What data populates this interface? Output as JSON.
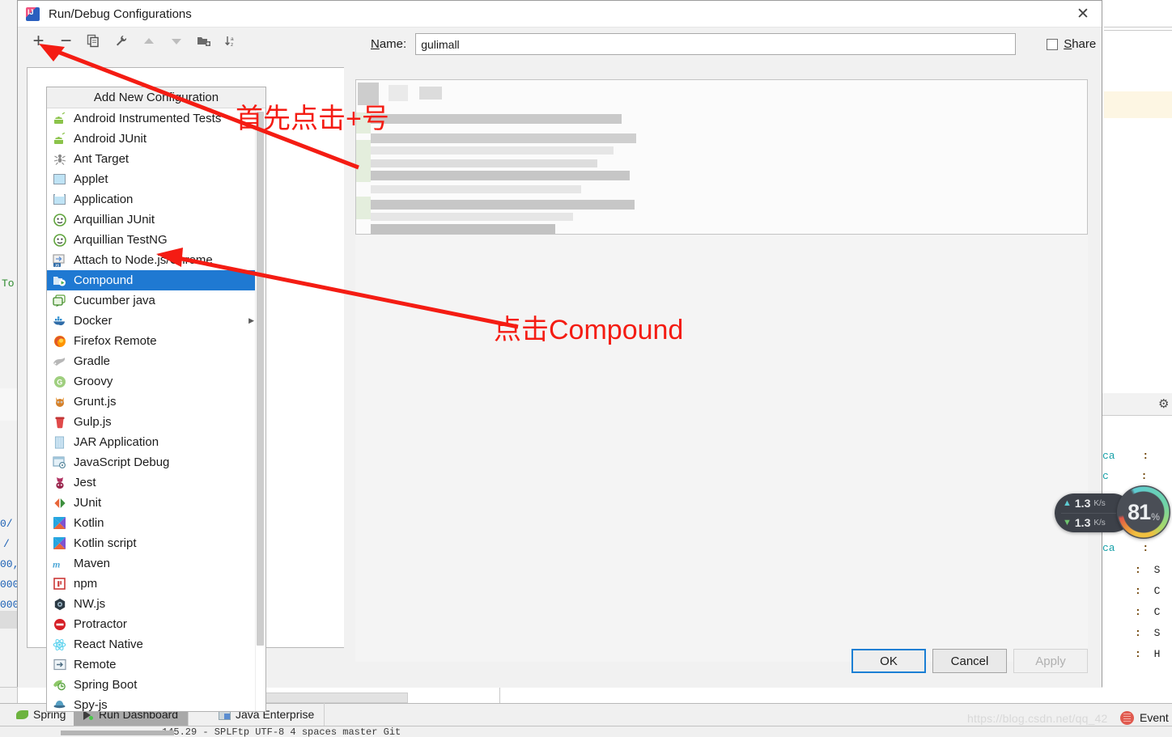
{
  "dialog": {
    "title": "Run/Debug Configurations",
    "icon": "intellij-logo-icon",
    "close_label": "✕",
    "toolbar": {
      "add_label": "+",
      "remove_label": "−",
      "copy_label": "copy-configuration-icon",
      "edit_templates_label": "wrench-icon",
      "move_up_label": "▲",
      "move_down_label": "▼",
      "new_folder_label": "new-folder-icon",
      "sort_label": "sort-alphabetically-icon"
    },
    "name_field": {
      "label_prefix": "N",
      "label_rest": "ame:",
      "value": "gulimall",
      "placeholder": ""
    },
    "share": {
      "label_prefix": "S",
      "label_rest": "hare",
      "checked": false
    },
    "buttons": {
      "ok": "OK",
      "cancel": "Cancel",
      "apply": "Apply"
    }
  },
  "popup": {
    "title": "Add New Configuration",
    "selected_index": 8,
    "selected_color": "#1f79d2",
    "items": [
      {
        "label": "Android Instrumented Tests",
        "icon": "android-icon"
      },
      {
        "label": "Android JUnit",
        "icon": "android-icon"
      },
      {
        "label": "Ant Target",
        "icon": "ant-icon"
      },
      {
        "label": "Applet",
        "icon": "applet-icon"
      },
      {
        "label": "Application",
        "icon": "application-icon"
      },
      {
        "label": "Arquillian JUnit",
        "icon": "arquillian-icon"
      },
      {
        "label": "Arquillian TestNG",
        "icon": "arquillian-icon"
      },
      {
        "label": "Attach to Node.js/Chrome",
        "icon": "nodejs-attach-icon"
      },
      {
        "label": "Compound",
        "icon": "compound-icon"
      },
      {
        "label": "Cucumber java",
        "icon": "cucumber-icon"
      },
      {
        "label": "Docker",
        "icon": "docker-icon",
        "submenu": "▶"
      },
      {
        "label": "Firefox Remote",
        "icon": "firefox-icon"
      },
      {
        "label": "Gradle",
        "icon": "gradle-icon"
      },
      {
        "label": "Groovy",
        "icon": "groovy-icon"
      },
      {
        "label": "Grunt.js",
        "icon": "grunt-icon"
      },
      {
        "label": "Gulp.js",
        "icon": "gulp-icon"
      },
      {
        "label": "JAR Application",
        "icon": "jar-icon"
      },
      {
        "label": "JavaScript Debug",
        "icon": "javascript-debug-icon"
      },
      {
        "label": "Jest",
        "icon": "jest-icon"
      },
      {
        "label": "JUnit",
        "icon": "junit-icon"
      },
      {
        "label": "Kotlin",
        "icon": "kotlin-icon"
      },
      {
        "label": "Kotlin script",
        "icon": "kotlin-icon"
      },
      {
        "label": "Maven",
        "icon": "maven-icon"
      },
      {
        "label": "npm",
        "icon": "npm-icon"
      },
      {
        "label": "NW.js",
        "icon": "nwjs-icon"
      },
      {
        "label": "Protractor",
        "icon": "protractor-icon"
      },
      {
        "label": "React Native",
        "icon": "react-icon"
      },
      {
        "label": "Remote",
        "icon": "remote-icon"
      },
      {
        "label": "Spring Boot",
        "icon": "spring-boot-icon"
      },
      {
        "label": "Spy-js",
        "icon": "spyjs-icon"
      }
    ]
  },
  "annotations": [
    {
      "text": "首先点击+号",
      "color": "#f41c13"
    },
    {
      "text": "点击Compound",
      "color": "#f41c13"
    }
  ],
  "ide": {
    "tool_tabs": [
      {
        "label": "Spring",
        "icon": "spring-leaf-icon",
        "active": false
      },
      {
        "label": "Run Dashboard",
        "icon": "run-icon",
        "active": true
      },
      {
        "label": "Java Enterprise",
        "icon": "java-enterprise-icon",
        "active": false
      }
    ],
    "event_label": "Event",
    "watermark": "https://blog.csdn.net/qq_42",
    "status_text": "145.29 - SPLFtp UTF-8 4 spaces master Git",
    "gutter_snippets": [
      "To",
      "0/",
      "/",
      "00,",
      "000",
      "000"
    ],
    "right_table_rows": [
      {
        "cell": "ca",
        "sep": ":"
      },
      {
        "cell": "c",
        "sep": ":"
      },
      {
        "cell": "",
        "sep": ":"
      },
      {
        "cell": "",
        "sep": ":"
      },
      {
        "cell": "ca",
        "sep": ":"
      },
      {
        "cell": "S",
        "sep": ":"
      },
      {
        "cell": "C",
        "sep": ":"
      },
      {
        "cell": "C",
        "sep": ":"
      },
      {
        "cell": "S",
        "sep": ":"
      },
      {
        "cell": "H",
        "sep": ":"
      }
    ],
    "gear_label": "⚙"
  },
  "network_widget": {
    "upload": "1.3",
    "upload_unit": "K/s",
    "download": "1.3",
    "download_unit": "K/s",
    "cpu_value": "81",
    "cpu_unit": "%"
  }
}
